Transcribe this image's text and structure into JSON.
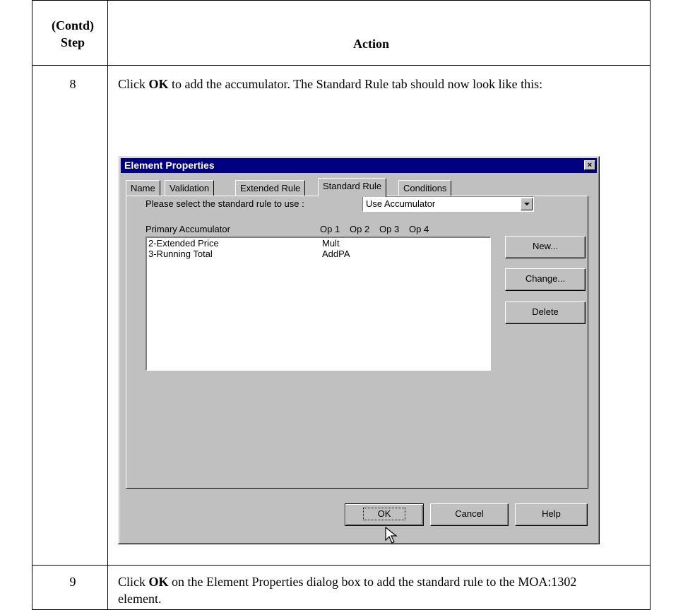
{
  "table": {
    "header_step": "(Contd)\nStep",
    "header_step_line1": "(Contd)",
    "header_step_line2": "Step",
    "header_action": "Action"
  },
  "rows": [
    {
      "step": "8",
      "text_before": "Click ",
      "bold": "OK",
      "text_after": " to add the accumulator. The Standard Rule tab should now look like this:"
    },
    {
      "step": "9",
      "text_before": "Click ",
      "bold": "OK",
      "text_after": " on the Element Properties dialog box to add the standard rule to the MOA:1302 element."
    }
  ],
  "dialog": {
    "title": "Element Properties",
    "close_glyph": "×",
    "tabs": [
      "Name",
      "Validation",
      "Extended Rule",
      "Standard Rule",
      "Conditions"
    ],
    "active_tab": "Standard Rule",
    "select_label": "Please select the standard rule to use :",
    "select_value": "Use Accumulator",
    "columns": [
      "Primary Accumulator",
      "Op 1",
      "Op 2",
      "Op 3",
      "Op 4"
    ],
    "list": [
      {
        "name": "2-Extended Price",
        "op1": "Mult"
      },
      {
        "name": "3-Running Total",
        "op1": "AddPA"
      }
    ],
    "buttons": {
      "new": "New...",
      "change": "Change...",
      "delete": "Delete",
      "ok": "OK",
      "cancel": "Cancel",
      "help": "Help"
    }
  },
  "colors": {
    "titlebar": "#000080",
    "face": "#c0c0c0"
  }
}
